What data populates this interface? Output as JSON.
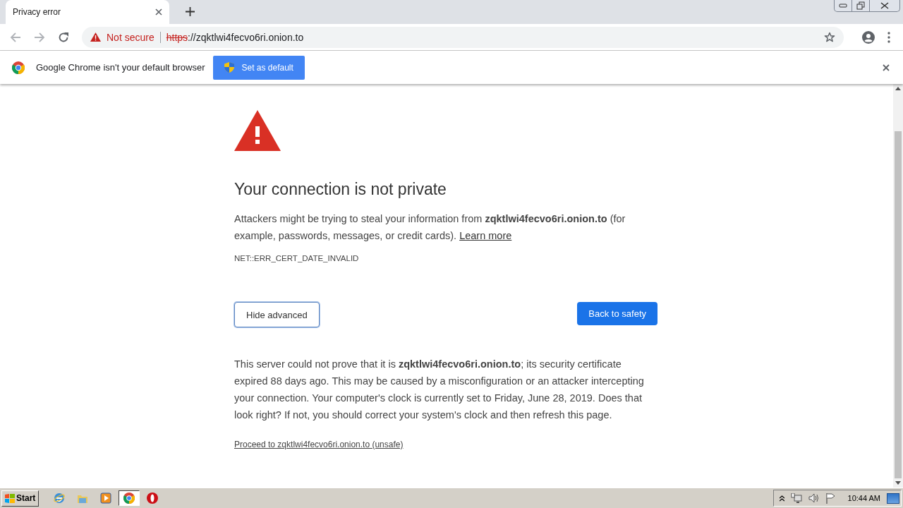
{
  "tab": {
    "title": "Privacy error",
    "selected": true
  },
  "address_bar": {
    "security_label": "Not secure",
    "url_scheme": "https",
    "url_rest": "://zqktlwi4fecvo6ri.onion.to"
  },
  "infobar": {
    "message": "Google Chrome isn't your default browser",
    "button": "Set as default"
  },
  "page": {
    "heading": "Your connection is not private",
    "warning": "Attackers might be trying to steal your information from **zqktlwi4fecvo6ri.onion.to** (for example, passwords, messages, or credit cards).",
    "learn_more": "Learn more",
    "error_code": "NET::ERR_CERT_DATE_INVALID",
    "secondary_button": "Hide advanced",
    "primary_button": "Back to safety",
    "details": "This server could not prove that it is **zqktlwi4fecvo6ri.onion.to**; its security certificate expired 88 days ago. This may be caused by a misconfiguration or an attacker intercepting your connection. Your computer's clock is currently set to Friday, June 28, 2019. Does that look right? If not, you should correct your system's clock and then refresh this page.",
    "proceed_link": "Proceed to zqktlwi4fecvo6ri.onion.to (unsafe)"
  },
  "taskbar": {
    "start": "Start",
    "apps": [
      {
        "kind": "ie",
        "selected": false
      },
      {
        "kind": "folder",
        "selected": false
      },
      {
        "kind": "media",
        "selected": false
      },
      {
        "kind": "chrome",
        "selected": true
      },
      {
        "kind": "opera",
        "selected": false
      }
    ],
    "clock": "10:44 AM"
  }
}
